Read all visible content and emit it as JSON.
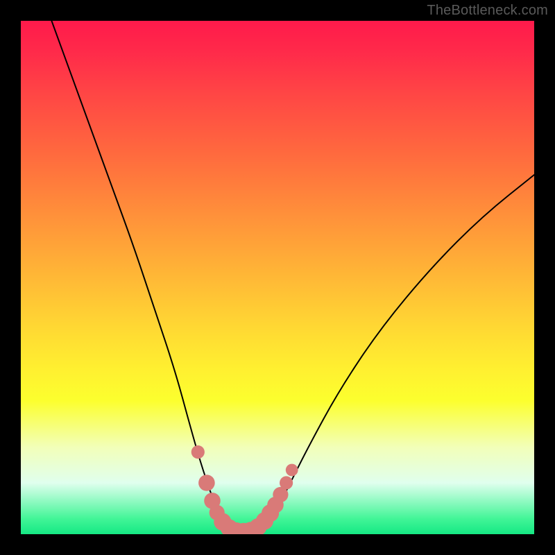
{
  "watermark": "TheBottleneck.com",
  "chart_data": {
    "type": "line",
    "title": "",
    "xlabel": "",
    "ylabel": "",
    "xlim": [
      0,
      100
    ],
    "ylim": [
      0,
      100
    ],
    "series": [
      {
        "name": "curve",
        "x": [
          6,
          10,
          14,
          18,
          22,
          26,
          30,
          33,
          35,
          37,
          38.5,
          40,
          42,
          44,
          46,
          48,
          50,
          52,
          56,
          62,
          70,
          80,
          90,
          100
        ],
        "y": [
          100,
          89,
          78,
          67,
          56,
          44,
          32,
          21,
          14,
          8,
          4,
          1.5,
          0.5,
          0.5,
          1,
          2.5,
          5,
          9,
          17,
          28,
          40,
          52,
          62,
          70
        ]
      }
    ],
    "markers": {
      "name": "highlight-points",
      "color": "#d97a78",
      "points": [
        {
          "x": 34.5,
          "y": 16,
          "r": 1.3
        },
        {
          "x": 36.2,
          "y": 10,
          "r": 1.6
        },
        {
          "x": 37.3,
          "y": 6.5,
          "r": 1.6
        },
        {
          "x": 38.2,
          "y": 4.2,
          "r": 1.5
        },
        {
          "x": 39.3,
          "y": 2.4,
          "r": 1.7
        },
        {
          "x": 40.6,
          "y": 1.2,
          "r": 1.7
        },
        {
          "x": 42.0,
          "y": 0.6,
          "r": 1.7
        },
        {
          "x": 43.4,
          "y": 0.5,
          "r": 1.7
        },
        {
          "x": 44.8,
          "y": 0.7,
          "r": 1.7
        },
        {
          "x": 46.2,
          "y": 1.4,
          "r": 1.7
        },
        {
          "x": 47.5,
          "y": 2.6,
          "r": 1.7
        },
        {
          "x": 48.6,
          "y": 4.1,
          "r": 1.7
        },
        {
          "x": 49.6,
          "y": 5.7,
          "r": 1.6
        },
        {
          "x": 50.6,
          "y": 7.7,
          "r": 1.5
        },
        {
          "x": 51.7,
          "y": 10.0,
          "r": 1.3
        },
        {
          "x": 52.8,
          "y": 12.5,
          "r": 1.2
        }
      ]
    },
    "gradient_stops": [
      {
        "pos": 0,
        "color": "#ff1a4b"
      },
      {
        "pos": 14,
        "color": "#ff4545"
      },
      {
        "pos": 38,
        "color": "#ff913a"
      },
      {
        "pos": 60,
        "color": "#ffd933"
      },
      {
        "pos": 74,
        "color": "#fcff2e"
      },
      {
        "pos": 90,
        "color": "#e0ffee"
      },
      {
        "pos": 100,
        "color": "#15e884"
      }
    ]
  }
}
